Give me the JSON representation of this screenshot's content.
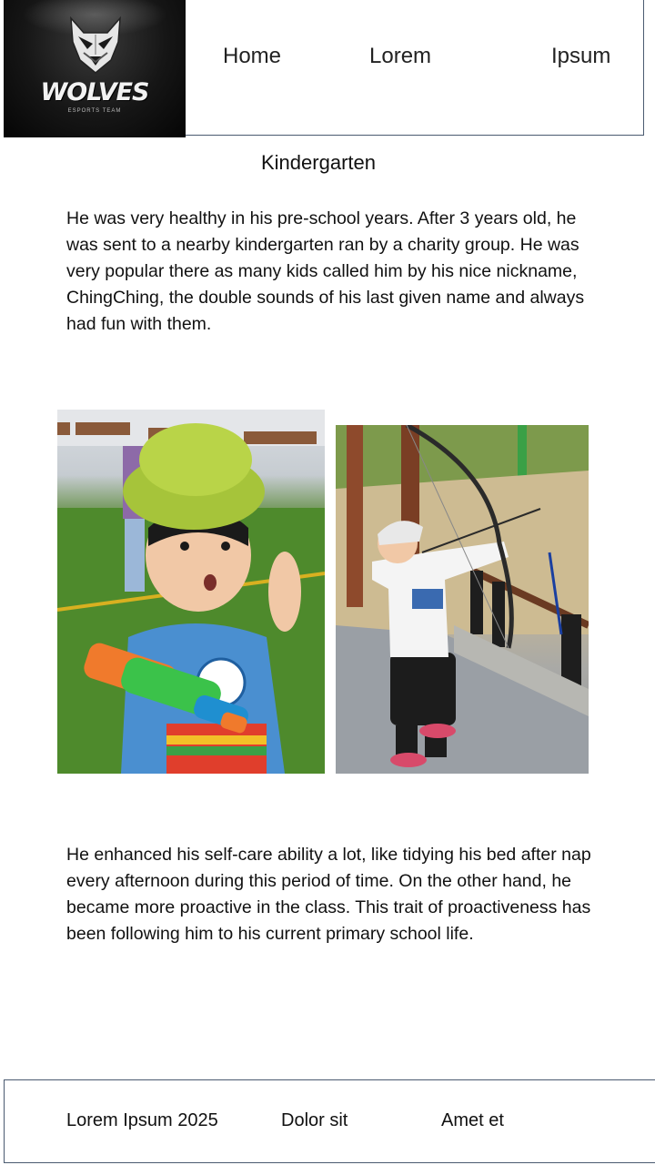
{
  "header": {
    "logo": {
      "title": "WOLVES",
      "subtitle": "ESPORTS TEAM",
      "icon": "wolf-head-icon"
    },
    "nav": [
      {
        "label": "Home"
      },
      {
        "label": "Lorem"
      },
      {
        "label": "Ipsum"
      }
    ],
    "border_color": "#4a5a70"
  },
  "main": {
    "title": "Kindergarten",
    "paragraphs": [
      "He was very healthy in his pre-school years.  After 3 years old, he was sent to a nearby kindergarten ran by a charity group.  He was very popular there as many kids called him by his nice nickname, ChingChing, the double sounds of his last given name and always had fun with them.",
      "He enhanced his self-care ability a lot, like tidying his bed after nap every afternoon during this period of time.   On the other hand, he became more proactive in the class.  This trait of proactiveness has been following him to his current primary school life."
    ]
  },
  "footer": {
    "items": [
      {
        "label": "Lorem Ipsum 2025"
      },
      {
        "label": "Dolor sit"
      },
      {
        "label": "Amet et"
      }
    ]
  }
}
